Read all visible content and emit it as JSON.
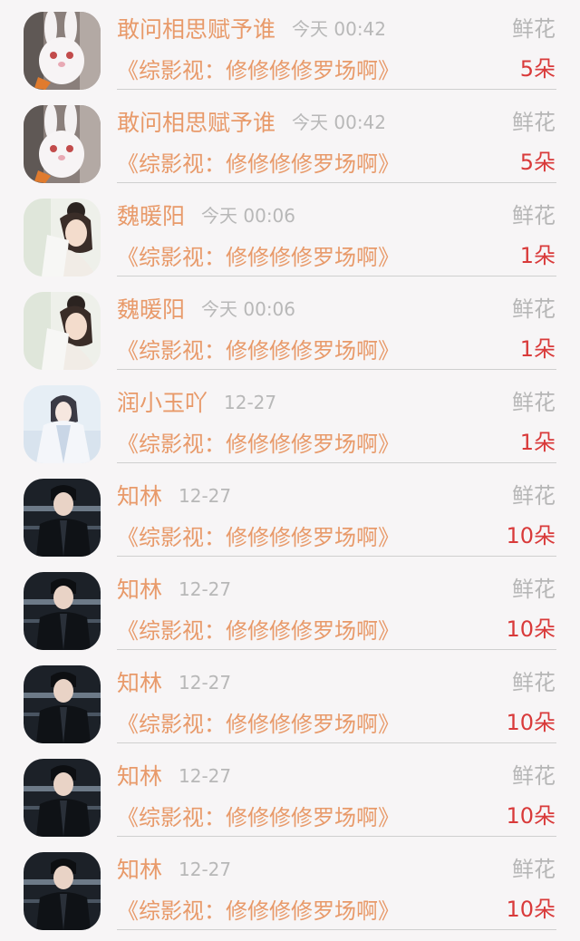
{
  "rows": [
    {
      "name": "敢问相思赋予谁",
      "time": "今天 00:42",
      "gift": "鲜花",
      "work": "《综影视：修修修修罗场啊》",
      "count": "5朵",
      "avatar_icon": "rabbit-avatar-icon"
    },
    {
      "name": "敢问相思赋予谁",
      "time": "今天 00:42",
      "gift": "鲜花",
      "work": "《综影视：修修修修罗场啊》",
      "count": "5朵",
      "avatar_icon": "rabbit-avatar-icon"
    },
    {
      "name": "魏暖阳",
      "time": "今天 00:06",
      "gift": "鲜花",
      "work": "《综影视：修修修修罗场啊》",
      "count": "1朵",
      "avatar_icon": "girl-avatar-icon"
    },
    {
      "name": "魏暖阳",
      "time": "今天 00:06",
      "gift": "鲜花",
      "work": "《综影视：修修修修罗场啊》",
      "count": "1朵",
      "avatar_icon": "girl-avatar-icon"
    },
    {
      "name": "润小玉吖",
      "time": "12-27",
      "gift": "鲜花",
      "work": "《综影视：修修修修罗场啊》",
      "count": "1朵",
      "avatar_icon": "costume-avatar-icon"
    },
    {
      "name": "知林",
      "time": "12-27",
      "gift": "鲜花",
      "work": "《综影视：修修修修罗场啊》",
      "count": "10朵",
      "avatar_icon": "man-avatar-icon"
    },
    {
      "name": "知林",
      "time": "12-27",
      "gift": "鲜花",
      "work": "《综影视：修修修修罗场啊》",
      "count": "10朵",
      "avatar_icon": "man-avatar-icon"
    },
    {
      "name": "知林",
      "time": "12-27",
      "gift": "鲜花",
      "work": "《综影视：修修修修罗场啊》",
      "count": "10朵",
      "avatar_icon": "man-avatar-icon"
    },
    {
      "name": "知林",
      "time": "12-27",
      "gift": "鲜花",
      "work": "《综影视：修修修修罗场啊》",
      "count": "10朵",
      "avatar_icon": "man-avatar-icon"
    },
    {
      "name": "知林",
      "time": "12-27",
      "gift": "鲜花",
      "work": "《综影视：修修修修罗场啊》",
      "count": "10朵",
      "avatar_icon": "man-avatar-icon"
    }
  ],
  "colors": {
    "background": "#f7f5f6",
    "name": "#e89a6a",
    "time": "#b8b8b8",
    "gift": "#b6b6b6",
    "count": "#d93a3a",
    "divider": "#cfcfcf"
  }
}
